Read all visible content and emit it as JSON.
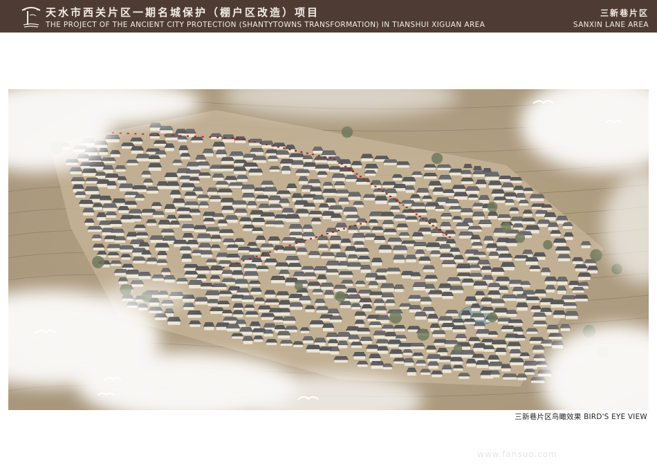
{
  "header": {
    "title_cn": "天水市西关片区一期名城保护（棚户区改造）项目",
    "title_en": "THE PROJECT OF THE ANCIENT CITY PROTECTION (SHANTYTOWNS TRANSFORMATION) IN TIANSHUI XIGUAN AREA",
    "area_cn": "三新巷片区",
    "area_en": "SANXIN LANE AREA",
    "logo_icon": "pagoda-roof-logo-icon"
  },
  "render": {
    "caption": "三新巷片区鸟瞰效果 BIRD'S EYE VIEW",
    "subject_icon": "aerial-rendering-image"
  },
  "watermark": {
    "text": "www.fansuo.com"
  },
  "colors": {
    "header_bg": "#4e3c34",
    "header_text": "#f2ede6",
    "ground": "#b9a68a",
    "roof": "#5a5a5c",
    "wall": "#ece6d6",
    "lantern": "#a02020"
  }
}
